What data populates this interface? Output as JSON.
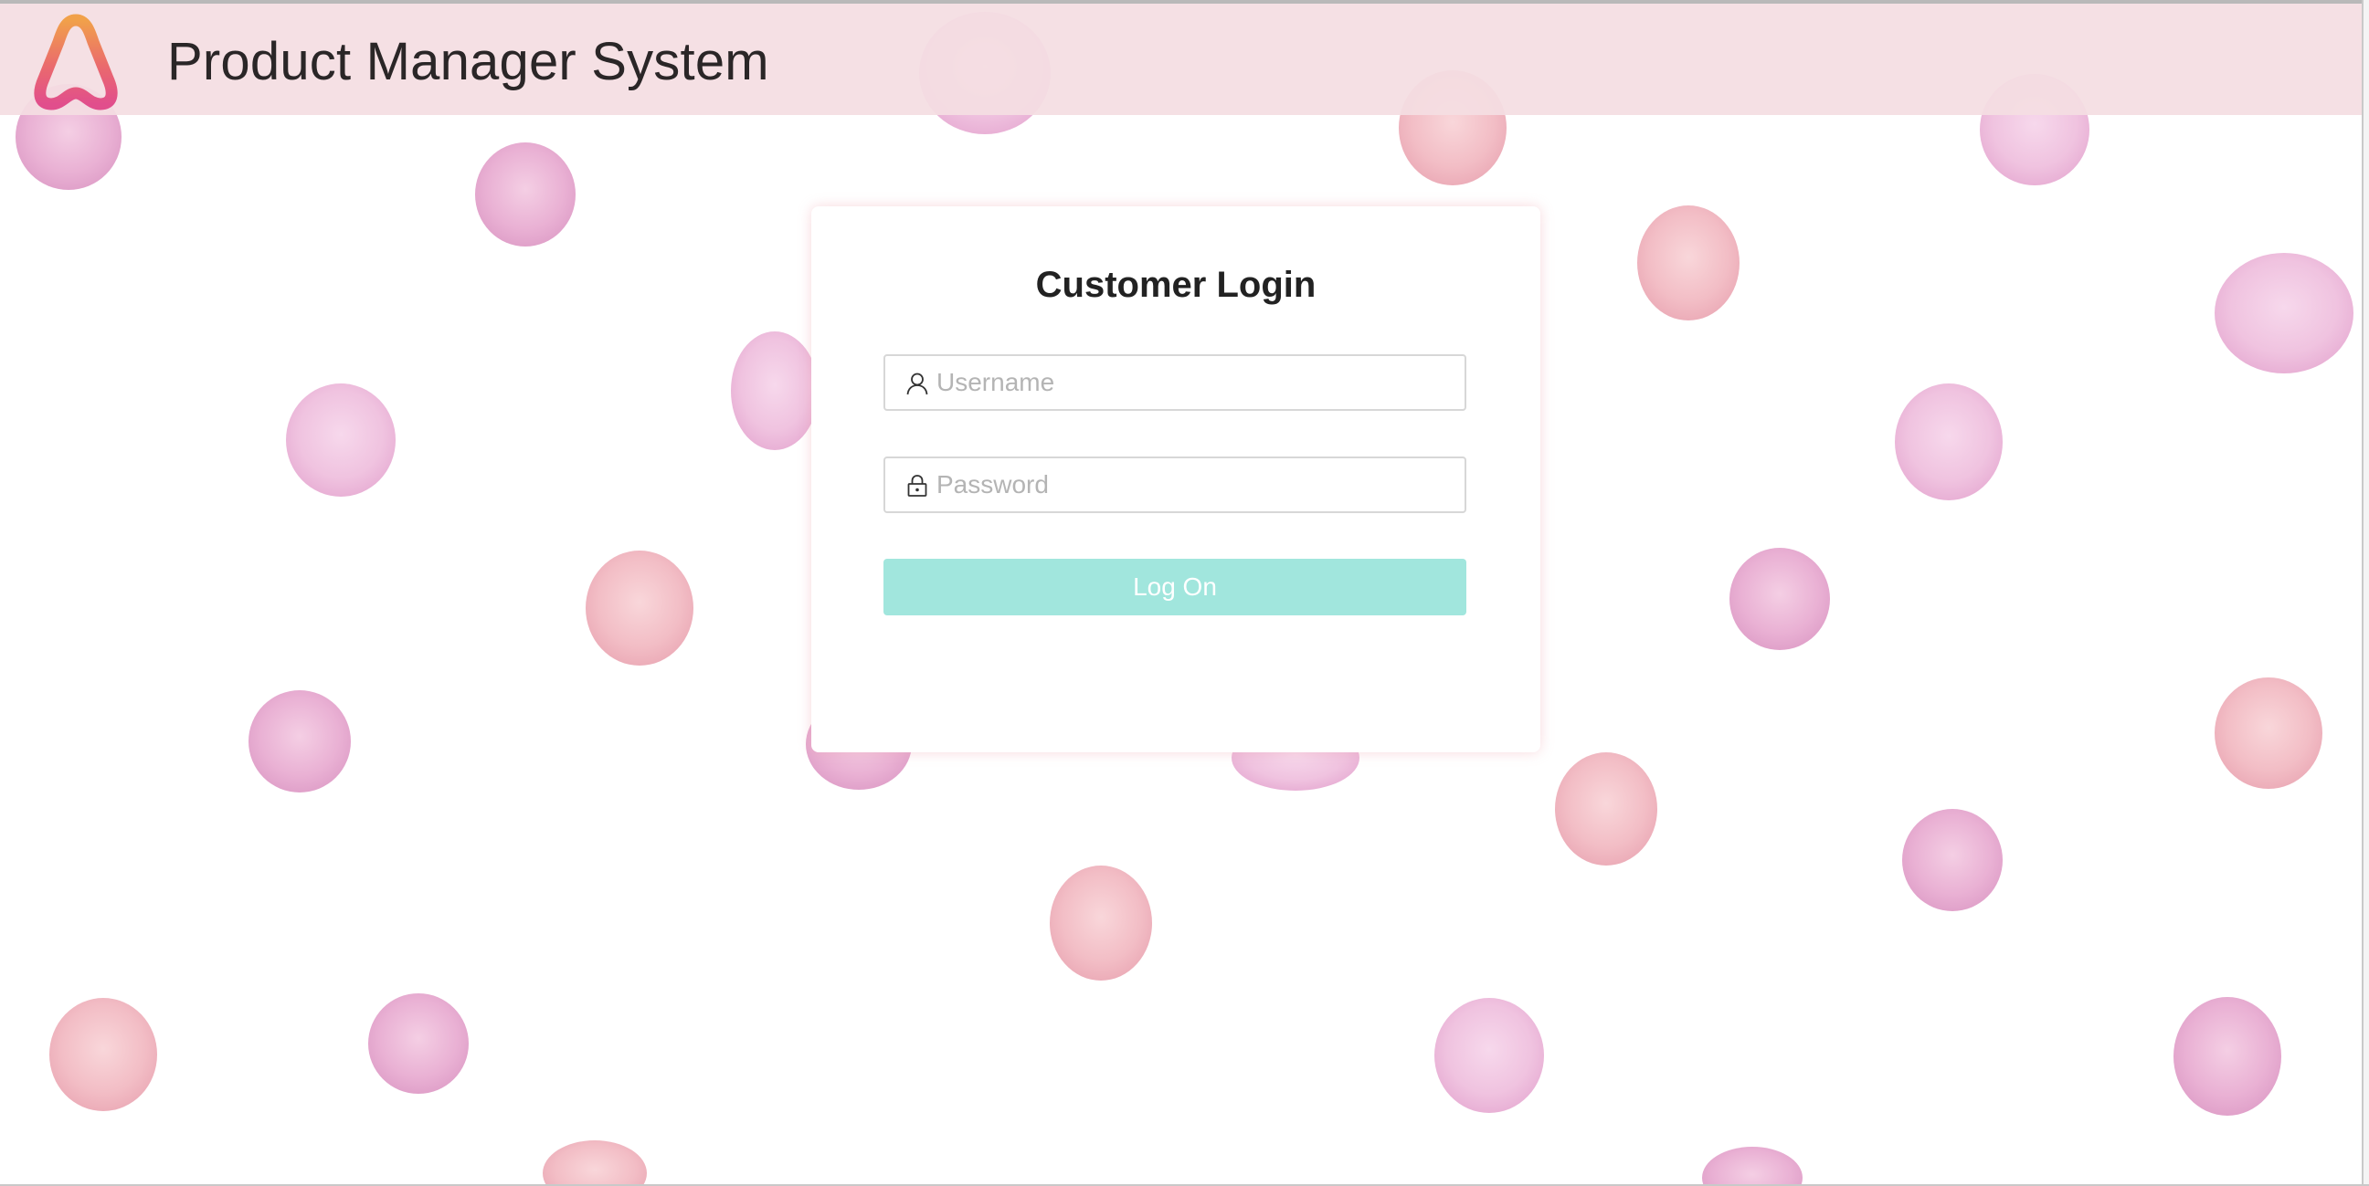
{
  "header": {
    "app_title": "Product Manager System",
    "logo_icon": "stylized-a-logo-icon"
  },
  "login": {
    "title": "Customer Login",
    "username": {
      "placeholder": "Username",
      "value": "",
      "icon": "user-icon"
    },
    "password": {
      "placeholder": "Password",
      "value": "",
      "icon": "lock-icon"
    },
    "submit_label": "Log On"
  },
  "theme": {
    "header_bg": "#f4dee2",
    "button_bg": "#a1e6dd",
    "dot_colors": [
      "#e8a9cc",
      "#f2b6bd",
      "#eebbd9"
    ]
  }
}
